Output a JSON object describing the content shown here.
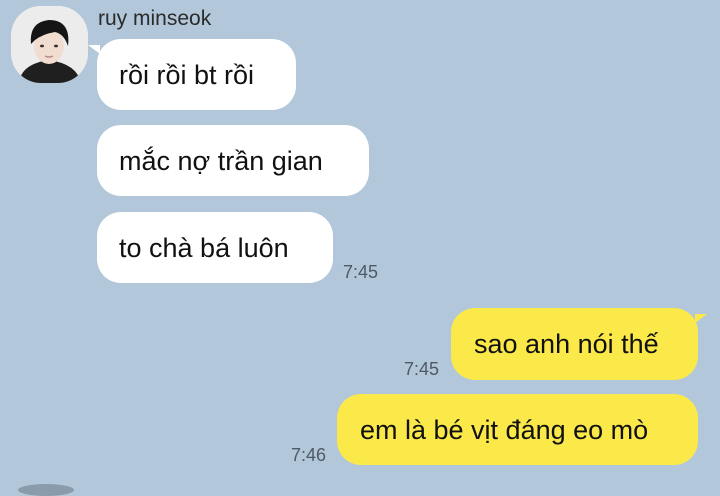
{
  "conversation": {
    "sender_name": "ruy minseok",
    "incoming": [
      {
        "text": "rồi rồi bt rồi"
      },
      {
        "text": "mắc nợ trần gian"
      },
      {
        "text": "to chà bá luôn",
        "time": "7:45"
      }
    ],
    "outgoing": [
      {
        "text": "sao anh nói thế",
        "time": "7:45"
      },
      {
        "text": "em là bé vịt đáng eo mò",
        "time": "7:46"
      }
    ]
  },
  "colors": {
    "background": "#b2c7da",
    "incoming_bubble": "#ffffff",
    "outgoing_bubble": "#fbe94a"
  }
}
